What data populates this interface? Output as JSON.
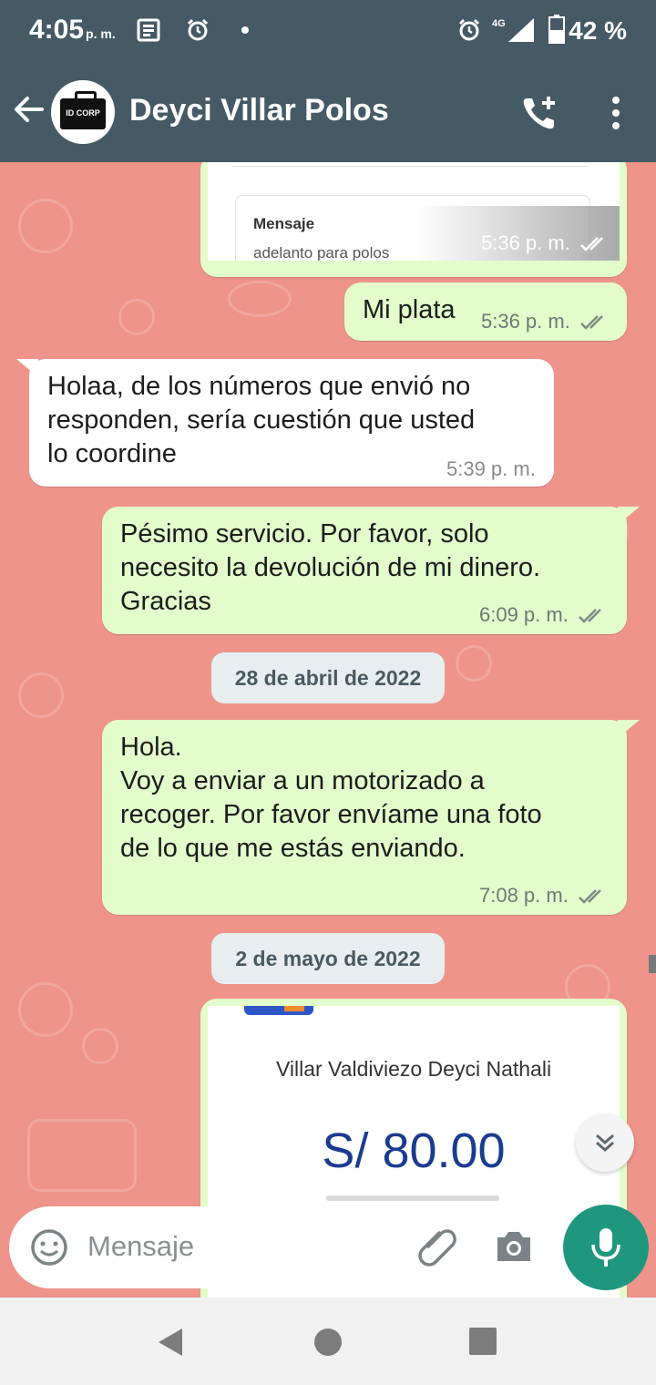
{
  "status_bar": {
    "time": "4:05",
    "ampm": "p. m.",
    "network": "4G",
    "battery": "42 %"
  },
  "header": {
    "avatar_text": "ID CORP",
    "contact_name": "Deyci Villar Polos",
    "icons": [
      "back-arrow-icon",
      "add-call-icon",
      "more-vert-icon"
    ]
  },
  "messages": [
    {
      "type": "image",
      "direction": "out",
      "card_label": "Mensaje",
      "card_value": "adelanto para polos",
      "time": "5:36 p. m."
    },
    {
      "type": "text",
      "direction": "out",
      "text": "Mi plata",
      "time": "5:36 p. m."
    },
    {
      "type": "text",
      "direction": "in",
      "text": "Holaa, de los números que envió no\nresponden, sería cuestión que usted\nlo coordine",
      "time": "5:39 p. m."
    },
    {
      "type": "text",
      "direction": "out",
      "text": "Pésimo servicio. Por favor, solo\nnecesito la devolución de mi dinero.\nGracias",
      "time": "6:09 p. m."
    },
    {
      "type": "date",
      "text": "28 de abril de 2022"
    },
    {
      "type": "text",
      "direction": "out",
      "text": "Hola.\nVoy a enviar a un motorizado a\nrecoger. Por favor envíame una foto\nde lo que me estás enviando.",
      "time": "7:08 p. m."
    },
    {
      "type": "date",
      "text": "2 de mayo de 2022"
    },
    {
      "type": "image",
      "direction": "out",
      "card_name": "Villar Valdiviezo Deyci Nathali",
      "card_amount": "S/ 80.00"
    }
  ],
  "input": {
    "placeholder": "Mensaje",
    "icons": [
      "emoji-icon",
      "attach-icon",
      "camera-icon",
      "mic-icon"
    ]
  },
  "colors": {
    "header": "#455a64",
    "chat_bg": "#ee948a",
    "outgoing": "#e2fdcb",
    "incoming": "#ffffff",
    "mic": "#1f977e",
    "amount": "#1a3b8f"
  }
}
